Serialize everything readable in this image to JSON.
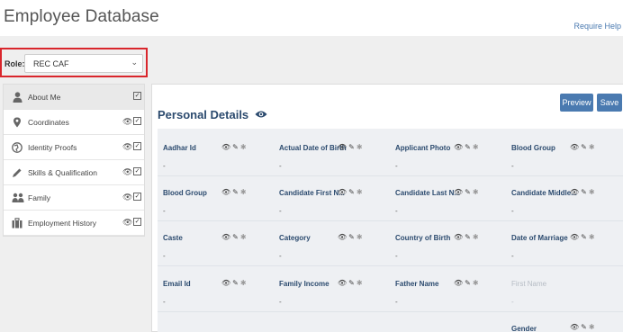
{
  "header": {
    "title": "Employee Database",
    "help_link": "Require Help"
  },
  "role": {
    "label": "Role:",
    "selected": "REC CAF"
  },
  "sidebar": {
    "items": [
      {
        "label": "About Me",
        "icon": "user-icon",
        "active": true,
        "show_eye": false
      },
      {
        "label": "Coordinates",
        "icon": "map-marker-icon",
        "active": false,
        "show_eye": true
      },
      {
        "label": "Identity Proofs",
        "icon": "globe-icon",
        "active": false,
        "show_eye": true
      },
      {
        "label": "Skills & Qualification",
        "icon": "pencil-icon",
        "active": false,
        "show_eye": true
      },
      {
        "label": "Family",
        "icon": "users-icon",
        "active": false,
        "show_eye": true
      },
      {
        "label": "Employment History",
        "icon": "briefcase-icon",
        "active": false,
        "show_eye": true
      }
    ]
  },
  "panel": {
    "title": "Personal Details",
    "preview_label": "Preview",
    "save_label": "Save",
    "fields": [
      [
        {
          "label": "Aadhar Id",
          "value": "-"
        },
        {
          "label": "Actual Date of Birth",
          "value": "-"
        },
        {
          "label": "Applicant Photo",
          "value": "-"
        },
        {
          "label": "Blood Group",
          "value": "-"
        }
      ],
      [
        {
          "label": "Blood Group",
          "value": "-"
        },
        {
          "label": "Candidate First N...",
          "value": "-"
        },
        {
          "label": "Candidate Last N...",
          "value": "-"
        },
        {
          "label": "Candidate Middle...",
          "value": "-"
        }
      ],
      [
        {
          "label": "Caste",
          "value": "-"
        },
        {
          "label": "Category",
          "value": "-"
        },
        {
          "label": "Country of Birth",
          "value": "-"
        },
        {
          "label": "Date of Marriage",
          "value": "-"
        }
      ],
      [
        {
          "label": "Email Id",
          "value": "-"
        },
        {
          "label": "Family Income",
          "value": "-"
        },
        {
          "label": "Father Name",
          "value": "-"
        },
        {
          "label": "First Name",
          "value": "-",
          "muted": true
        }
      ],
      [
        {
          "label": "Gender",
          "value": ""
        }
      ]
    ]
  }
}
